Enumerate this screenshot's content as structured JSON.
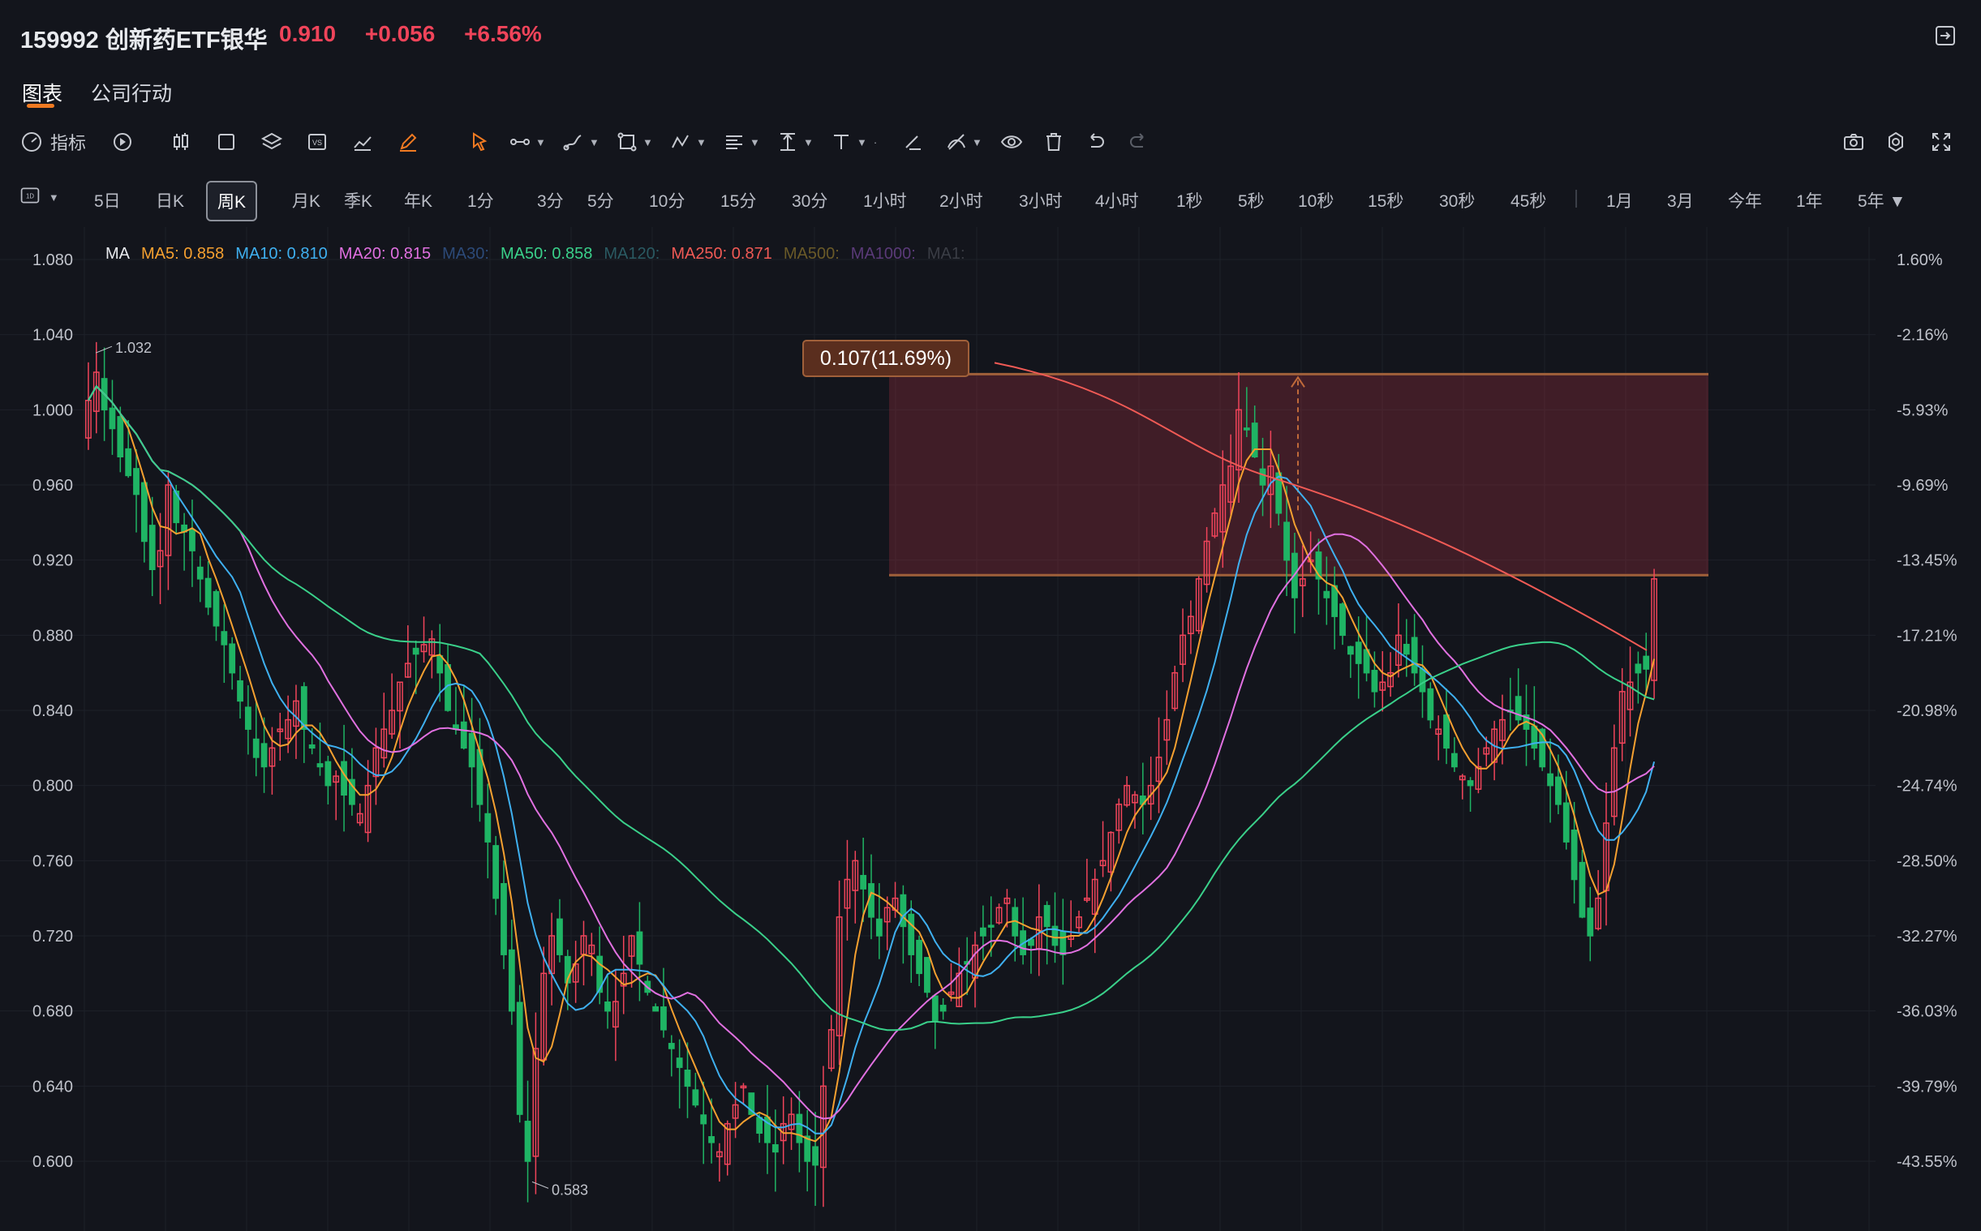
{
  "header": {
    "title": "159992 创新药ETF银华",
    "price": "0.910",
    "change": "+0.056",
    "change_pct": "+6.56%"
  },
  "tabs": [
    {
      "label": "图表",
      "active": true
    },
    {
      "label": "公司行动",
      "active": false
    }
  ],
  "toolbar": {
    "indicator_label": "指标",
    "icons": [
      "gauge-icon",
      "replay-icon",
      "candle-type-icon",
      "rectangle-icon",
      "layers-icon",
      "vs-icon",
      "area-chart-icon",
      "pencil-icon",
      "cursor-icon",
      "line-tool-icon",
      "pen-tool-icon",
      "shape-tool-icon",
      "pattern-tool-icon",
      "fibonacci-icon",
      "measure-icon",
      "text-tool-icon",
      "brush-icon",
      "drawing-visibility-icon",
      "eye-icon",
      "trash-icon",
      "undo-icon",
      "redo-icon",
      "camera-icon",
      "settings-icon",
      "fullscreen-icon"
    ]
  },
  "periods": {
    "selector": "1D",
    "items": [
      "5日",
      "日K",
      "周K",
      "月K",
      "季K",
      "年K",
      "1分",
      "3分",
      "5分",
      "10分",
      "15分",
      "30分",
      "1小时",
      "2小时",
      "3小时",
      "4小时",
      "1秒",
      "5秒",
      "10秒",
      "15秒",
      "30秒",
      "45秒"
    ],
    "active": "周K",
    "ranges": [
      "1月",
      "3月",
      "今年",
      "1年",
      "5年"
    ]
  },
  "ma_legend": {
    "prefix": "MA",
    "items": [
      {
        "label": "MA5: 0.858",
        "color": "#f5a030"
      },
      {
        "label": "MA10: 0.810",
        "color": "#3fb0f0"
      },
      {
        "label": "MA20: 0.815",
        "color": "#e070e0"
      },
      {
        "label": "MA30:",
        "color": "#2c4a78"
      },
      {
        "label": "MA50: 0.858",
        "color": "#3ad08a"
      },
      {
        "label": "MA120:",
        "color": "#2a5a62"
      },
      {
        "label": "MA250: 0.871",
        "color": "#f05a55"
      },
      {
        "label": "MA500:",
        "color": "#6a5a28"
      },
      {
        "label": "MA1000:",
        "color": "#5a3a78"
      },
      {
        "label": "MA1:",
        "color": "#3a3d45"
      }
    ]
  },
  "chart_data": {
    "type": "candlestick",
    "y_left_ticks": [
      "1.080",
      "1.040",
      "1.000",
      "0.960",
      "0.920",
      "0.880",
      "0.840",
      "0.800",
      "0.760",
      "0.720",
      "0.680",
      "0.640",
      "0.600"
    ],
    "y_right_ticks": [
      "1.60%",
      "-2.16%",
      "-5.93%",
      "-9.69%",
      "-13.45%",
      "-17.21%",
      "-20.98%",
      "-24.74%",
      "-28.50%",
      "-32.27%",
      "-36.03%",
      "-39.79%",
      "-43.55%"
    ],
    "ylim": [
      0.576,
      1.093
    ],
    "high_label": "1.032",
    "low_label": "0.583",
    "measure": {
      "label": "0.107(11.69%)",
      "low": 0.912,
      "high": 1.019
    },
    "colors": {
      "up": "#f0445a",
      "down": "#1fb464"
    },
    "closes": [
      1.005,
      1.02,
      1.0,
      0.99,
      0.975,
      0.965,
      0.955,
      0.93,
      0.915,
      0.925,
      0.96,
      0.94,
      0.935,
      0.925,
      0.91,
      0.895,
      0.885,
      0.875,
      0.86,
      0.845,
      0.83,
      0.815,
      0.81,
      0.82,
      0.83,
      0.835,
      0.845,
      0.83,
      0.82,
      0.81,
      0.8,
      0.805,
      0.795,
      0.79,
      0.785,
      0.8,
      0.82,
      0.83,
      0.84,
      0.855,
      0.865,
      0.87,
      0.875,
      0.878,
      0.86,
      0.84,
      0.83,
      0.82,
      0.81,
      0.79,
      0.77,
      0.74,
      0.71,
      0.68,
      0.625,
      0.6,
      0.66,
      0.7,
      0.72,
      0.71,
      0.695,
      0.705,
      0.72,
      0.715,
      0.69,
      0.68,
      0.685,
      0.7,
      0.72,
      0.705,
      0.69,
      0.68,
      0.67,
      0.66,
      0.65,
      0.64,
      0.63,
      0.62,
      0.61,
      0.605,
      0.62,
      0.63,
      0.64,
      0.625,
      0.615,
      0.61,
      0.605,
      0.62,
      0.625,
      0.61,
      0.6,
      0.598,
      0.64,
      0.67,
      0.73,
      0.75,
      0.76,
      0.745,
      0.73,
      0.72,
      0.735,
      0.74,
      0.725,
      0.71,
      0.7,
      0.69,
      0.675,
      0.68,
      0.69,
      0.7,
      0.705,
      0.715,
      0.72,
      0.725,
      0.735,
      0.74,
      0.72,
      0.71,
      0.715,
      0.73,
      0.725,
      0.715,
      0.71,
      0.72,
      0.73,
      0.74,
      0.75,
      0.76,
      0.775,
      0.79,
      0.8,
      0.795,
      0.79,
      0.8,
      0.815,
      0.835,
      0.86,
      0.88,
      0.89,
      0.91,
      0.93,
      0.945,
      0.96,
      0.97,
      1.0,
      0.99,
      0.975,
      0.96,
      0.97,
      0.945,
      0.92,
      0.9,
      0.91,
      0.92,
      0.91,
      0.9,
      0.89,
      0.88,
      0.87,
      0.865,
      0.86,
      0.85,
      0.855,
      0.86,
      0.88,
      0.87,
      0.86,
      0.85,
      0.835,
      0.83,
      0.82,
      0.81,
      0.805,
      0.8,
      0.81,
      0.82,
      0.83,
      0.835,
      0.84,
      0.835,
      0.83,
      0.82,
      0.81,
      0.8,
      0.79,
      0.77,
      0.75,
      0.73,
      0.72,
      0.74,
      0.78,
      0.82,
      0.85,
      0.855,
      0.86,
      0.862,
      0.91
    ]
  }
}
